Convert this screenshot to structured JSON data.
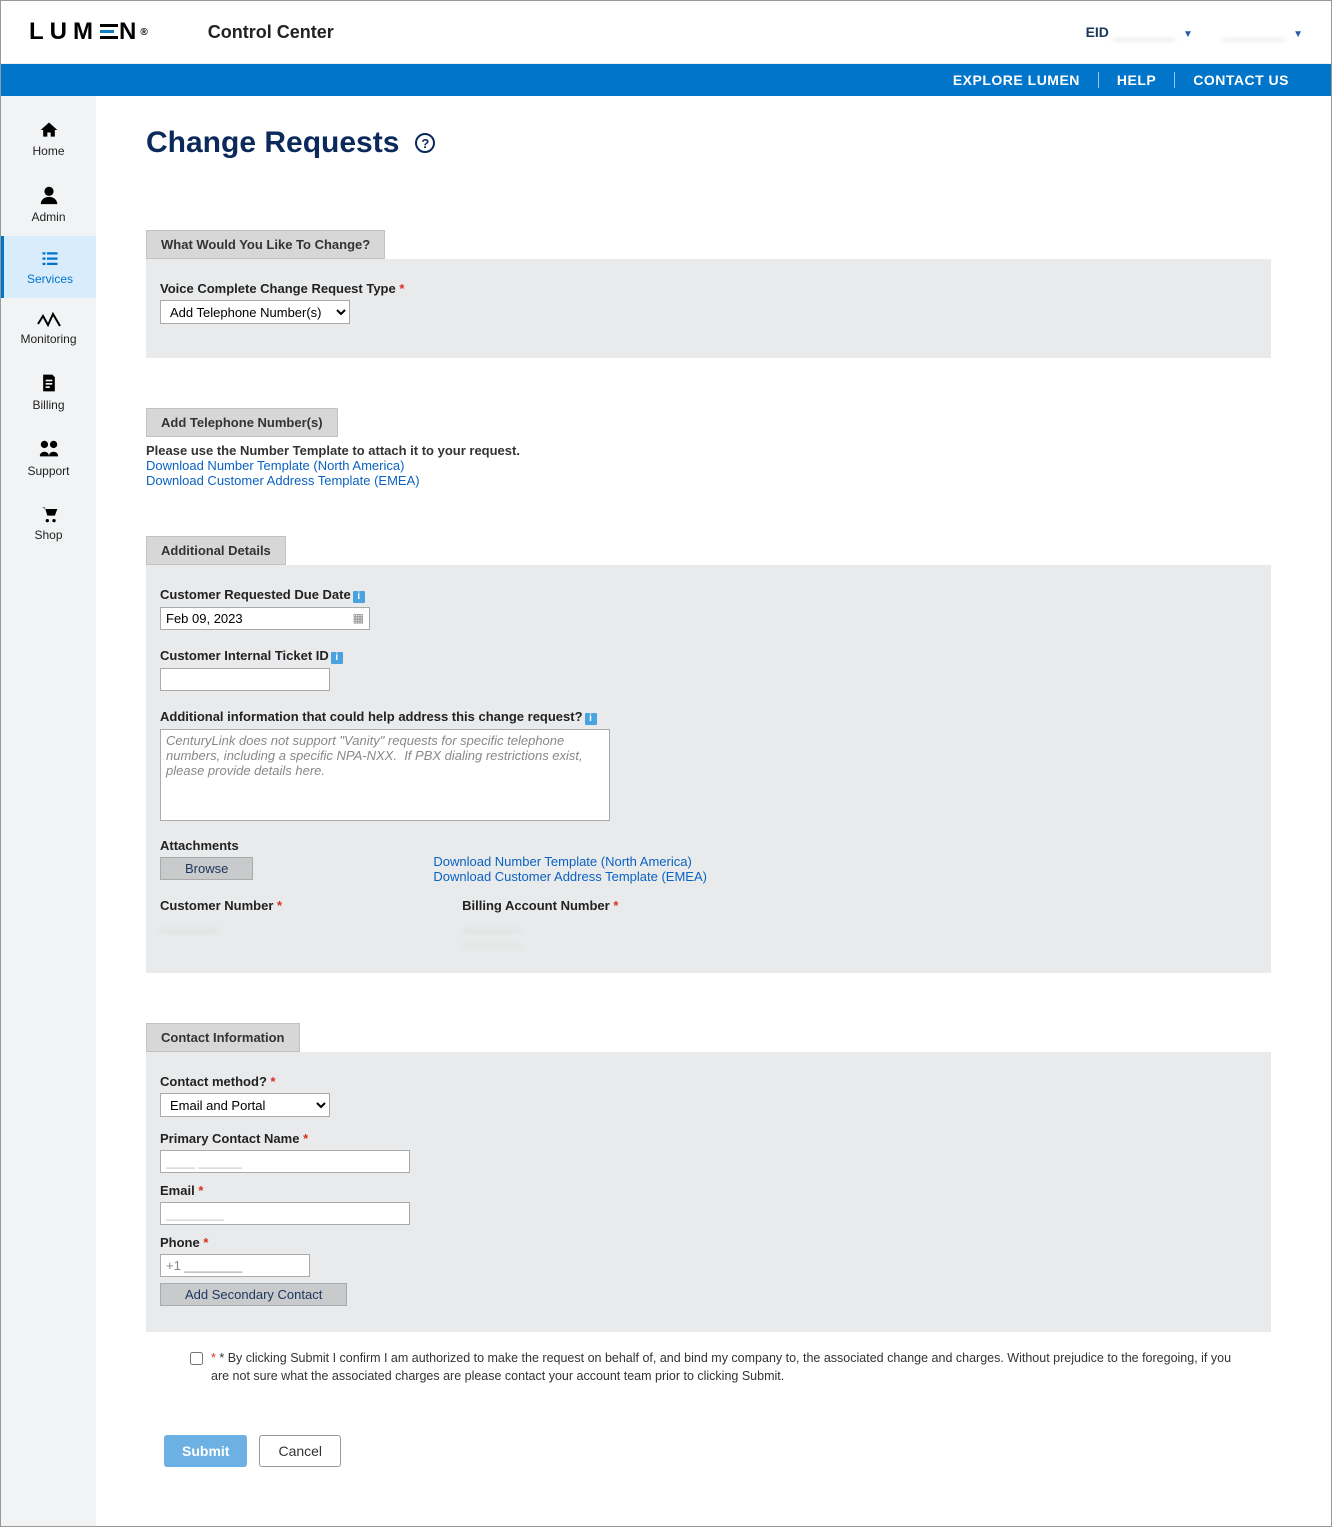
{
  "header": {
    "brand_parts": [
      "L",
      "U",
      "M",
      "N"
    ],
    "brand_suffix": "®",
    "app_title": "Control Center",
    "eid_label": "EID",
    "eid_value": "________",
    "user_value": "________"
  },
  "bluebar": {
    "explore": "EXPLORE LUMEN",
    "help": "HELP",
    "contact": "CONTACT US"
  },
  "sidebar": [
    {
      "key": "home",
      "label": "Home"
    },
    {
      "key": "admin",
      "label": "Admin"
    },
    {
      "key": "services",
      "label": "Services"
    },
    {
      "key": "monitoring",
      "label": "Monitoring"
    },
    {
      "key": "billing",
      "label": "Billing"
    },
    {
      "key": "support",
      "label": "Support"
    },
    {
      "key": "shop",
      "label": "Shop"
    }
  ],
  "page": {
    "title": "Change Requests"
  },
  "sec_change": {
    "tab": "What Would You Like To Change?",
    "type_label": "Voice Complete Change Request Type",
    "type_value": "Add Telephone Number(s)"
  },
  "sec_add": {
    "tab": "Add Telephone Number(s)",
    "note": "Please use the Number Template to attach it to your request.",
    "link1": "Download Number Template (North America)",
    "link2": "Download Customer Address Template (EMEA)"
  },
  "sec_details": {
    "tab": "Additional Details",
    "due_label": "Customer Requested Due Date",
    "due_value": "Feb 09, 2023",
    "ticket_label": "Customer Internal Ticket ID",
    "ticket_value": "",
    "addl_label": "Additional information that could help address this change request?",
    "addl_placeholder": "CenturyLink does not support \"Vanity\" requests for specific telephone numbers, including a specific NPA-NXX.  If PBX dialing restrictions exist, please provide details here.",
    "attach_label": "Attachments",
    "browse": "Browse",
    "link1": "Download Number Template (North America)",
    "link2": "Download Customer Address Template (EMEA)",
    "cust_num_label": "Customer Number",
    "cust_num_value": "________",
    "ban_label": "Billing Account Number",
    "ban_value_l1": "________",
    "ban_value_l2": "________"
  },
  "sec_contact": {
    "tab": "Contact Information",
    "method_label": "Contact method?",
    "method_value": "Email and Portal",
    "name_label": "Primary Contact Name",
    "name_value": "____ ______",
    "email_label": "Email",
    "email_value": "________",
    "phone_label": "Phone",
    "phone_prefix": "+1",
    "phone_value": "________",
    "add_secondary": "Add Secondary Contact"
  },
  "confirm": {
    "text": "* By clicking Submit I confirm I am authorized to make the request on behalf of, and bind my company to, the associated change and charges. Without prejudice to the foregoing, if you are not sure what the associated charges are please contact your account team prior to clicking Submit."
  },
  "buttons": {
    "submit": "Submit",
    "cancel": "Cancel"
  }
}
